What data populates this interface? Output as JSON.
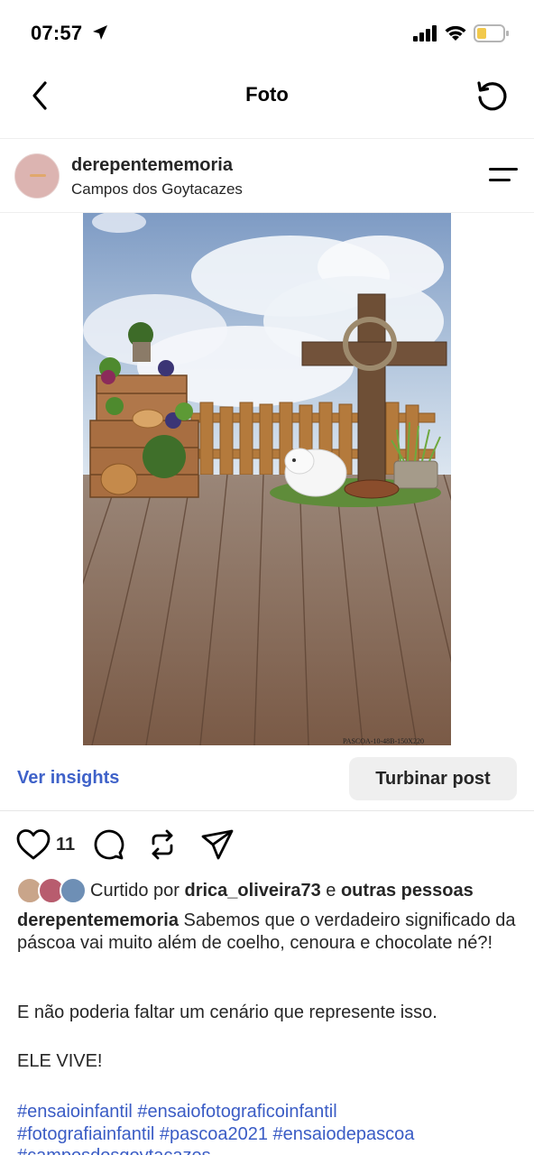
{
  "status": {
    "time": "07:57",
    "icons": [
      "location-arrow-icon",
      "cellular-signal-icon",
      "wifi-icon",
      "battery-icon"
    ]
  },
  "nav": {
    "title": "Foto",
    "back_icon": "chevron-left-icon",
    "refresh_icon": "refresh-icon"
  },
  "post": {
    "username": "derepentememoria",
    "location": "Campos dos Goytacazes",
    "menu_icon": "menu-icon",
    "photo_watermark": "PASCOA-10-48B-150X220"
  },
  "insights": {
    "link": "Ver insights",
    "boost_button": "Turbinar post"
  },
  "actions": {
    "like_count": "11",
    "icons": [
      "heart-icon",
      "comment-icon",
      "repost-icon",
      "share-icon"
    ]
  },
  "likes": {
    "prefix": "Curtido por",
    "user": "drica_oliveira73",
    "connector": "e",
    "others": "outras pessoas"
  },
  "caption": {
    "username": "derepentememoria",
    "text": "Sabemos que o verdadeiro significado da páscoa vai muito além de coelho, cenoura e chocolate né?!",
    "paragraph2": "E não poderia faltar um cenário que represente isso.",
    "paragraph3": "ELE VIVE!",
    "hashtag_line1": "#ensaioinfantil #ensaiofotograficoinfantil",
    "hashtag_line2": "#fotografiainfantil #pascoa2021 #ensaiodepascoa",
    "hashtag_line3": "#camposdosgoytacazes"
  },
  "colors": {
    "link_blue": "#3f62c9",
    "hashtag_blue": "#3a5cc5",
    "button_gray": "#efefef"
  }
}
